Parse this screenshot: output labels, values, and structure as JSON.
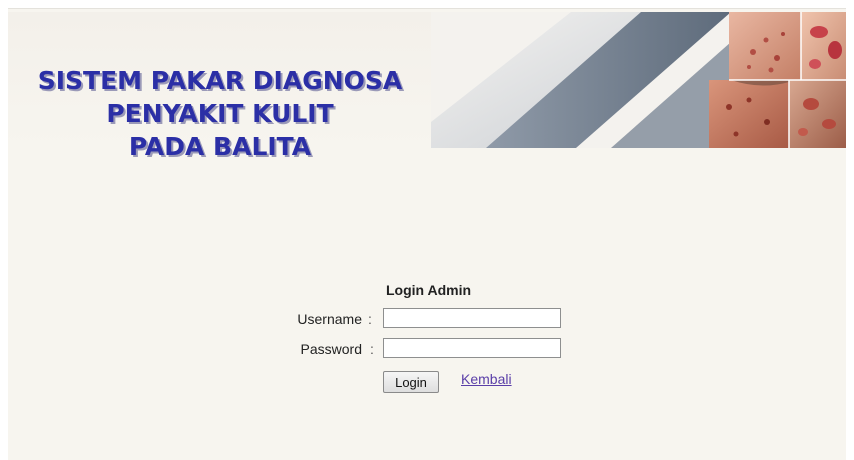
{
  "header": {
    "title_lines": [
      "SISTEM PAKAR DIAGNOSA",
      "PENYAKIT KULIT",
      "PADA BALITA"
    ]
  },
  "login": {
    "heading": "Login Admin",
    "username_label": "Username",
    "password_label": "Password",
    "separator": ":",
    "username_value": "",
    "password_value": "",
    "login_button": "Login",
    "back_link": "Kembali"
  },
  "colors": {
    "title": "#2b2fa6",
    "link": "#5a3ea8",
    "background": "#f7f5ef"
  }
}
